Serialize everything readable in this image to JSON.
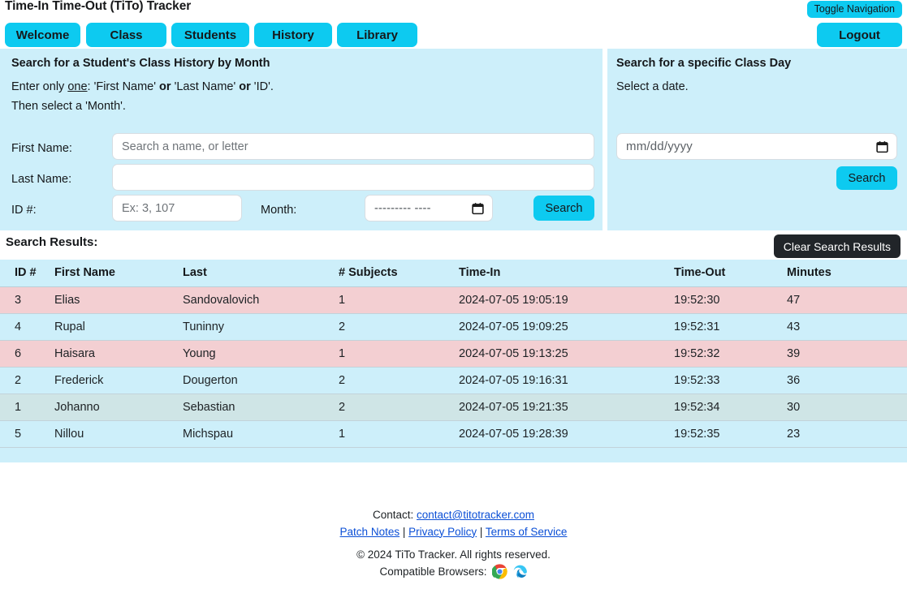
{
  "header": {
    "title": "Time-In Time-Out (TiTo) Tracker",
    "toggle_nav_label": "Toggle Navigation",
    "logout_label": "Logout"
  },
  "nav": {
    "items": [
      {
        "label": "Welcome"
      },
      {
        "label": "Class"
      },
      {
        "label": "Students"
      },
      {
        "label": "History"
      },
      {
        "label": "Library"
      }
    ]
  },
  "search_history_panel": {
    "heading": "Search for a Student's Class History by Month",
    "instruction_line1_pre": "Enter only ",
    "instruction_line1_one": "one",
    "instruction_line1_mid1": ": 'First Name' ",
    "instruction_line1_or1": "or",
    "instruction_line1_mid2": " 'Last Name' ",
    "instruction_line1_or2": "or",
    "instruction_line1_end": " 'ID'.",
    "instruction_line2": "Then select a 'Month'.",
    "first_name_label": "First Name:",
    "first_name_placeholder": "Search a name, or letter",
    "first_name_value": "",
    "last_name_label": "Last Name:",
    "last_name_placeholder": "",
    "last_name_value": "",
    "id_label": "ID #:",
    "id_placeholder": "Ex: 3, 107",
    "id_value": "",
    "month_label": "Month:",
    "month_placeholder": "--------- ----",
    "month_value": "",
    "search_label": "Search"
  },
  "search_day_panel": {
    "heading": "Search for a specific Class Day",
    "instruction": "Select a date.",
    "date_placeholder": "mm/dd/yyyy",
    "date_value": "",
    "search_label": "Search"
  },
  "results": {
    "label": "Search Results:",
    "clear_label": "Clear Search Results",
    "columns": [
      "ID #",
      "First Name",
      "Last",
      "# Subjects",
      "Time-In",
      "Time-Out",
      "Minutes"
    ],
    "rows": [
      {
        "id": "3",
        "first": "Elias",
        "last": "Sandovalovich",
        "subjects": "1",
        "time_in": "2024-07-05 19:05:19",
        "time_out": "19:52:30",
        "minutes": "47",
        "style": "row-pink"
      },
      {
        "id": "4",
        "first": "Rupal",
        "last": "Tuninny",
        "subjects": "2",
        "time_in": "2024-07-05 19:09:25",
        "time_out": "19:52:31",
        "minutes": "43",
        "style": "row-cyan"
      },
      {
        "id": "6",
        "first": "Haisara",
        "last": "Young",
        "subjects": "1",
        "time_in": "2024-07-05 19:13:25",
        "time_out": "19:52:32",
        "minutes": "39",
        "style": "row-pink"
      },
      {
        "id": "2",
        "first": "Frederick",
        "last": "Dougerton",
        "subjects": "2",
        "time_in": "2024-07-05 19:16:31",
        "time_out": "19:52:33",
        "minutes": "36",
        "style": "row-cyan"
      },
      {
        "id": "1",
        "first": "Johanno",
        "last": "Sebastian",
        "subjects": "2",
        "time_in": "2024-07-05 19:21:35",
        "time_out": "19:52:34",
        "minutes": "30",
        "style": "row-grey"
      },
      {
        "id": "5",
        "first": "Nillou",
        "last": "Michspau",
        "subjects": "1",
        "time_in": "2024-07-05 19:28:39",
        "time_out": "19:52:35",
        "minutes": "23",
        "style": "row-cyan"
      }
    ]
  },
  "footer": {
    "contact_label": "Contact:",
    "contact_email": "contact@titotracker.com",
    "patch_notes": "Patch Notes",
    "sep1": " | ",
    "privacy": "Privacy Policy",
    "sep2": " | ",
    "terms": "Terms of Service",
    "copyright": "© 2024 TiTo Tracker. All rights reserved.",
    "browsers_label": "Compatible Browsers:",
    "browser_icons": [
      "chrome-icon",
      "edge-icon"
    ]
  },
  "colors": {
    "accent_cyan": "#0dcaf0",
    "panel_bg": "#cdeffa",
    "row_pink": "#f3cfd2",
    "row_cyan": "#cdeffa",
    "row_grey": "#cfe5e6",
    "dark_button": "#212529",
    "link": "#0b4fd6"
  }
}
